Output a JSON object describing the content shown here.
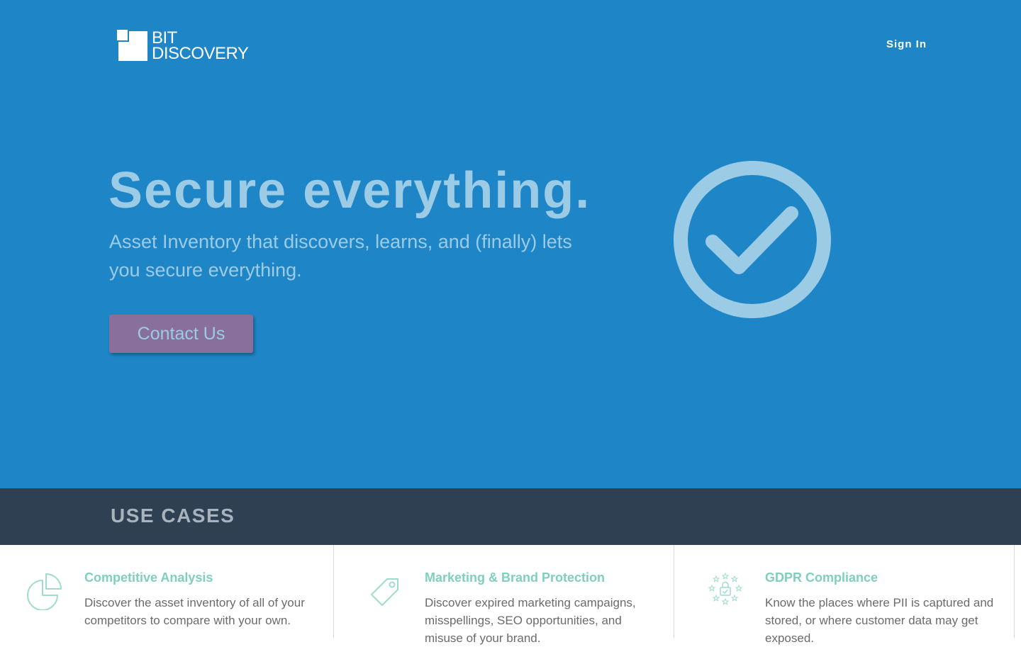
{
  "header": {
    "logo_line1": "BIT",
    "logo_line2": "DISCOVERY",
    "signin_label": "Sign In"
  },
  "hero": {
    "headline": "Secure everything.",
    "subhead": "Asset Inventory that discovers, learns, and (finally) lets you secure everything.",
    "cta_label": "Contact Us",
    "illustration_icon": "check-circle-icon"
  },
  "use_cases": {
    "title": "USE CASES",
    "items": [
      {
        "icon": "pie-chart-icon",
        "title": "Competitive Analysis",
        "description": "Discover the asset inventory of all of your competitors to compare with your own."
      },
      {
        "icon": "tag-icon",
        "title": "Marketing & Brand Protection",
        "description": "Discover expired marketing campaigns, misspellings, SEO opportunities, and misuse of your brand."
      },
      {
        "icon": "eu-lock-icon",
        "title": "GDPR Compliance",
        "description": "Know the places where PII is captured and stored, or where customer data may get exposed."
      }
    ]
  },
  "colors": {
    "hero_bg": "#1e86c7",
    "hero_text": "#9ccbe6",
    "cta_bg": "#896f9b",
    "section_bar": "#2f4052",
    "accent_green": "#7fcfbf"
  }
}
